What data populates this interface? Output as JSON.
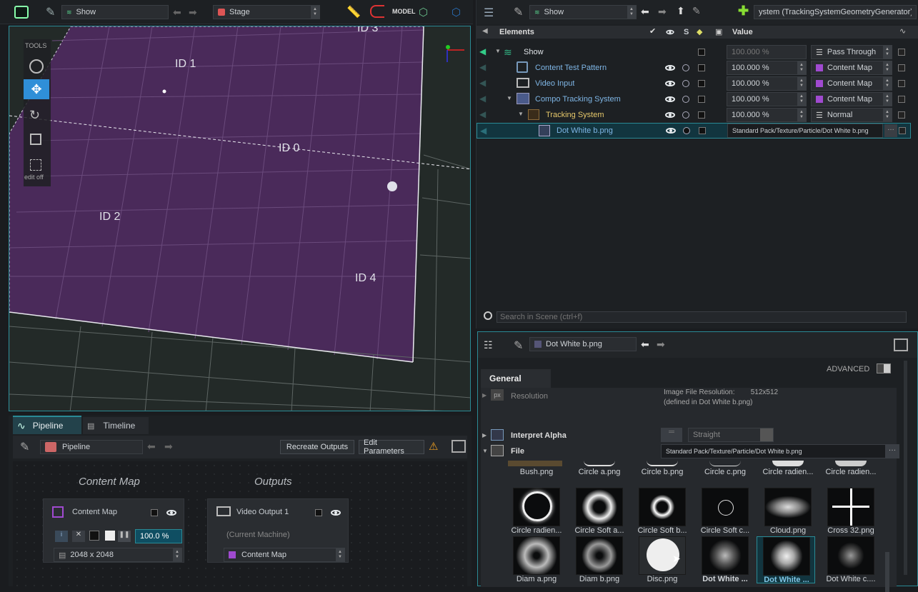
{
  "viewport": {
    "toolbar": {
      "scene": "Show",
      "stage": "Stage",
      "model_label": "MODEL"
    },
    "tools_label": "TOOLS",
    "edit_off": "edit off",
    "markers": [
      "ID 3",
      "ID 1",
      "ID 0",
      "ID 2",
      "ID 4"
    ]
  },
  "pipeline": {
    "tab_pipeline": "Pipeline",
    "tab_timeline": "Timeline",
    "name": "Pipeline",
    "recreate": "Recreate Outputs",
    "edit_params": "Edit Parameters",
    "col_content": "Content Map",
    "col_outputs": "Outputs",
    "node_cm": {
      "title": "Content Map",
      "percent": "100.0 %",
      "res": "2048 x 2048"
    },
    "node_vo": {
      "title": "Video Output 1",
      "sub": "(Current Machine)",
      "map": "Content Map"
    }
  },
  "elements": {
    "toolbar": {
      "scene": "Show",
      "path": "ystem (TrackingSystemGeometryGenerator)"
    },
    "header": {
      "elements": "Elements",
      "s": "S",
      "value": "Value"
    },
    "rows": [
      {
        "name": "Show",
        "value": "100.000 %",
        "mode": "Pass Through"
      },
      {
        "name": "Content Test Pattern",
        "value": "100.000 %",
        "mode": "Content Map"
      },
      {
        "name": "Video Input",
        "value": "100.000 %",
        "mode": "Content Map"
      },
      {
        "name": "Compo Tracking System",
        "value": "100.000 %",
        "mode": "Content Map"
      },
      {
        "name": "Tracking System",
        "value": "100.000 %",
        "mode": "Normal"
      },
      {
        "name": "Dot White b.png",
        "value": "Standard Pack/Texture/Particle/Dot White b.png"
      }
    ],
    "search_placeholder": "Search in Scene (ctrl+f)"
  },
  "properties": {
    "title": "Dot White b.png",
    "advanced": "ADVANCED",
    "tab_general": "General",
    "resolution_label": "Resolution",
    "resolution_value": "Image File Resolution:        512x512",
    "resolution_sub": "(defined in Dot White b.png)",
    "interpret_alpha": "Interpret Alpha",
    "alpha_value": "Straight",
    "file_label": "File",
    "file_path": "Standard Pack/Texture/Particle/Dot White b.png",
    "thumbs_row1": [
      "Bush.png",
      "Circle a.png",
      "Circle b.png",
      "Circle c.png",
      "Circle radien...",
      "Circle radien..."
    ],
    "thumbs_row2": [
      "Circle radien...",
      "Circle Soft a...",
      "Circle Soft b...",
      "Circle Soft c...",
      "Cloud.png",
      "Cross 32.png"
    ],
    "thumbs_row3": [
      "Diam a.png",
      "Diam b.png",
      "Disc.png",
      "Dot White ...",
      "Dot White ...",
      "Dot White c...."
    ]
  }
}
